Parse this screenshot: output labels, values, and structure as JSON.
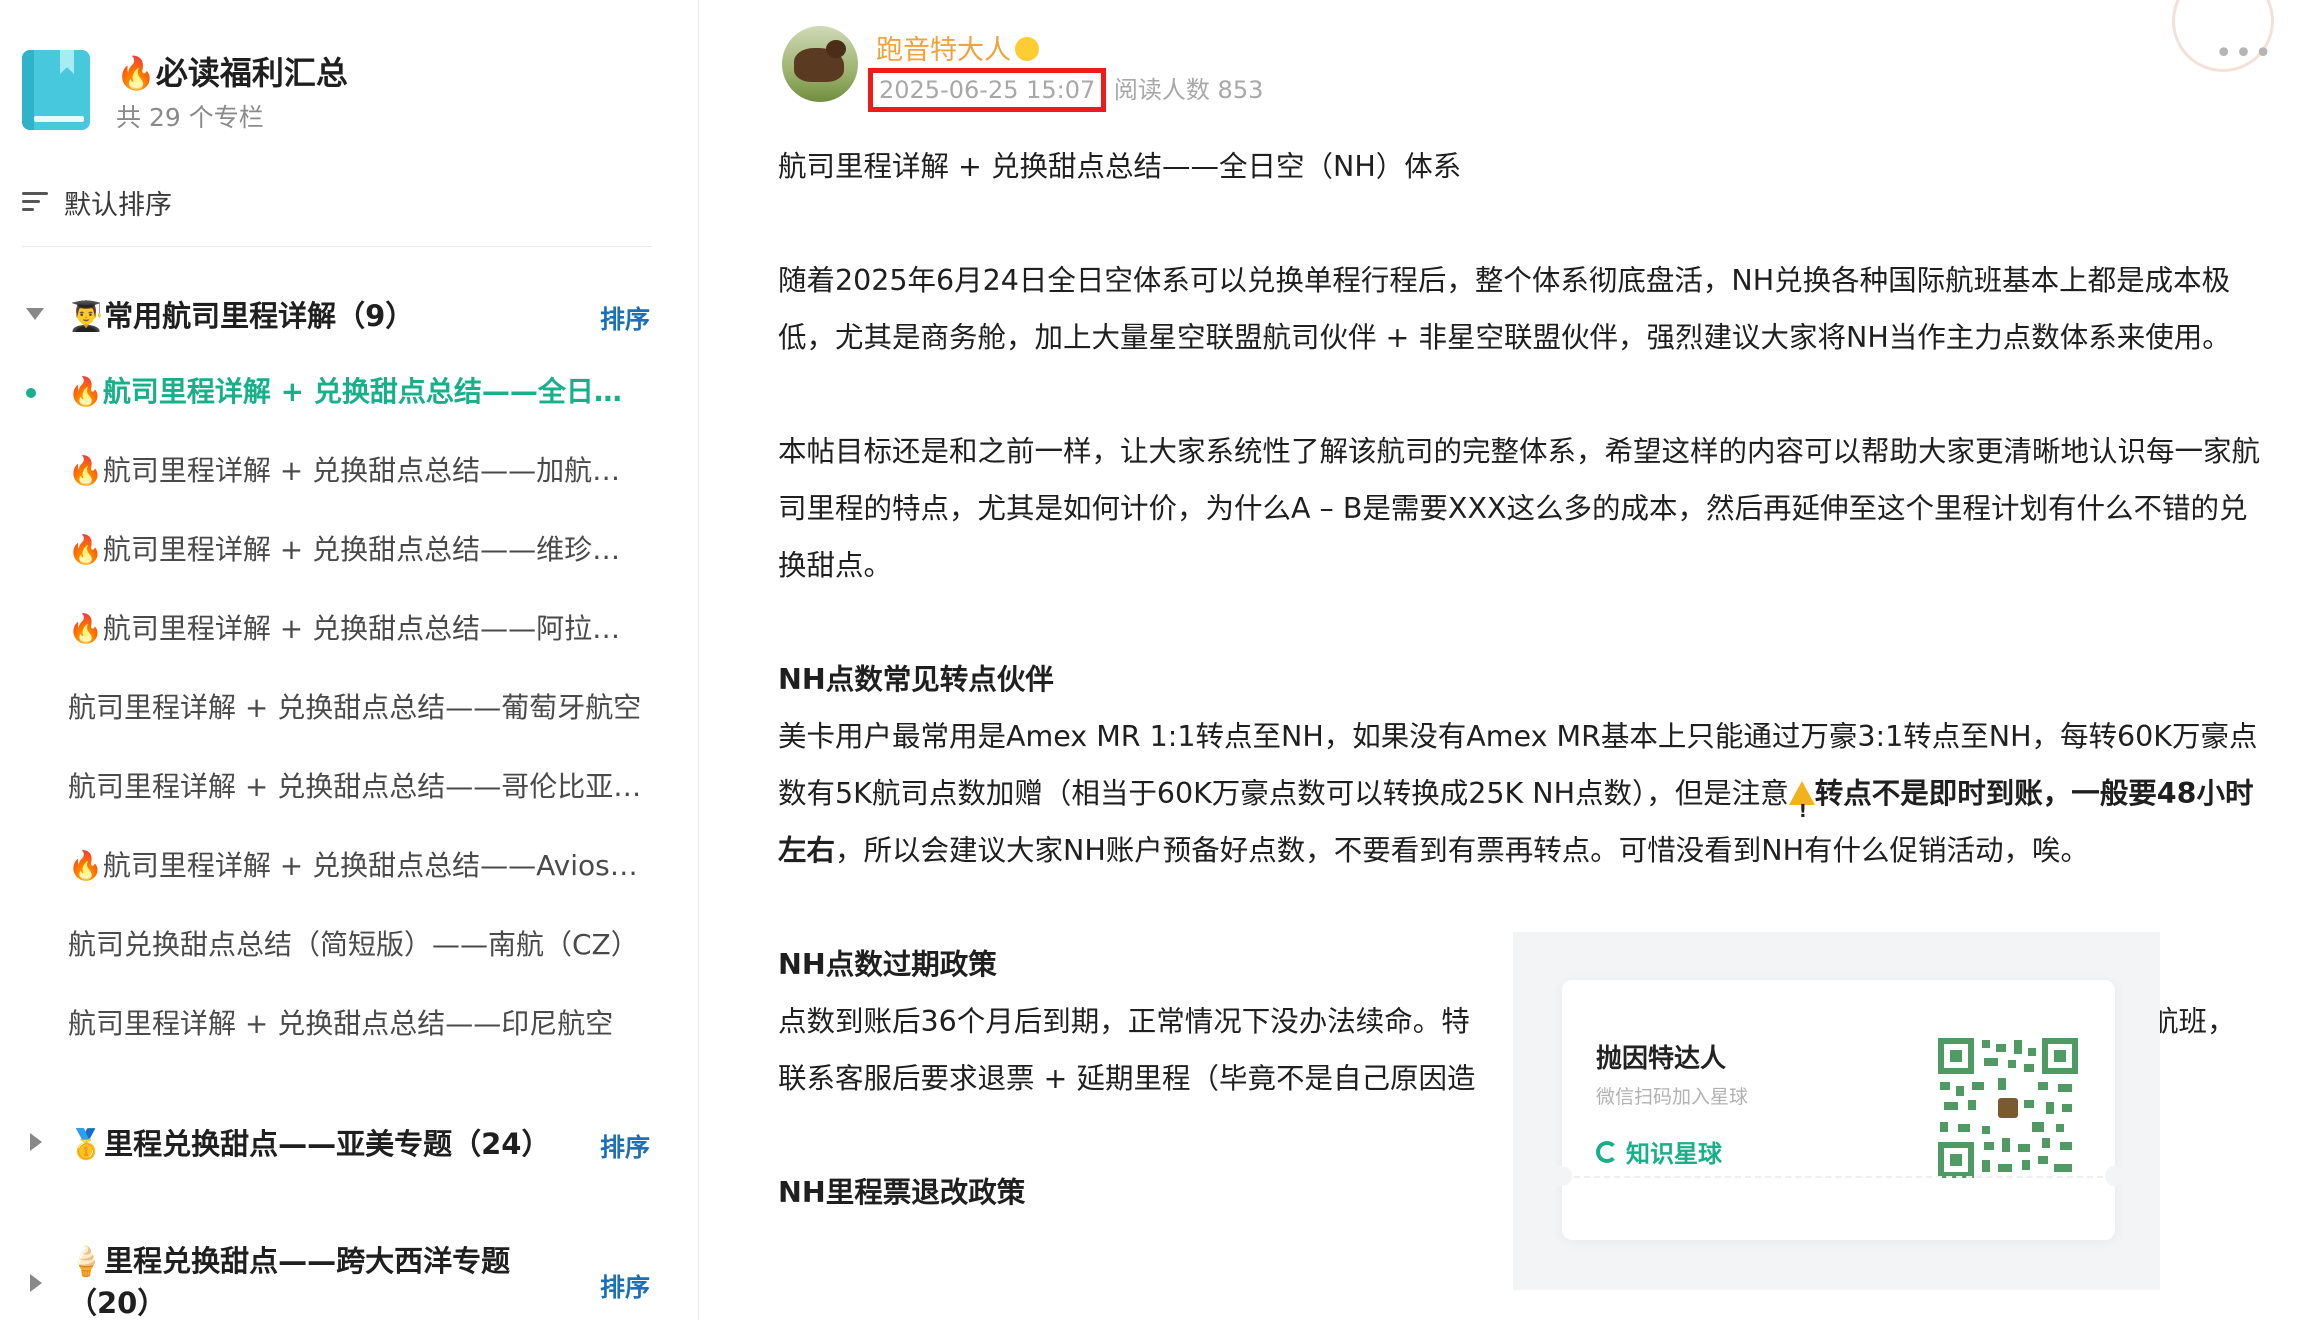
{
  "sidebar": {
    "column_title": "🔥必读福利汇总",
    "column_count": "共 29 个专栏",
    "sort_label": "默认排序",
    "groups": [
      {
        "title": "👨‍🎓常用航司里程详解（9）",
        "sort_label": "排序"
      },
      {
        "title": "🥇里程兑换甜点——亚美专题（24）",
        "sort_label": "排序"
      },
      {
        "title": "🍦里程兑换甜点——跨大西洋专题",
        "title_line2": "（20）",
        "sort_label": "排序"
      }
    ],
    "articles": [
      "🔥航司里程详解 + 兑换甜点总结——全日空（NH）体系",
      "🔥航司里程详解 + 兑换甜点总结——加航（AC）",
      "🔥航司里程详解 + 兑换甜点总结——维珍航空",
      "🔥航司里程详解 + 兑换甜点总结——阿拉斯加航空",
      "航司里程详解 + 兑换甜点总结——葡萄牙航空",
      "航司里程详解 + 兑换甜点总结——哥伦比亚航空",
      "🔥航司里程详解 + 兑换甜点总结——Avios体系",
      "航司兑换甜点总结（简短版）——南航（CZ）",
      "航司里程详解 + 兑换甜点总结——印尼航空"
    ],
    "active_index": 0
  },
  "post": {
    "author": "跑音特大人",
    "date": "2025-06-25 15:07",
    "views": "阅读人数 853",
    "title": "航司里程详解 + 兑换甜点总结——全日空（NH）体系",
    "p1": "随着2025年6月24日全日空体系可以兑换单程行程后，整个体系彻底盘活，NH兑换各种国际航班基本上都是成本极低，尤其是商务舱，加上大量星空联盟航司伙伴 + 非星空联盟伙伴，强烈建议大家将NH当作主力点数体系来使用。",
    "p2": "本帖目标还是和之前一样，让大家系统性了解该航司的完整体系，希望这样的内容可以帮助大家更清晰地认识每一家航司里程的特点，尤其是如何计价，为什么A – B是需要XXX这么多的成本，然后再延伸至这个里程计划有什么不错的兑换甜点。",
    "h1": "NH点数常见转点伙伴",
    "p3a": "美卡用户最常用是Amex MR 1:1转点至NH，如果没有Amex MR基本上只能通过万豪3:1转点至NH，每转60K万豪点数有5K航司点数加赠（相当于60K万豪点数可以转换成25K NH点数），但是注意",
    "p3b": "转点不是即时到账，一般要48小时左右",
    "p3c": "，所以会建议大家NH账户预备好点数，不要看到有票再转点。可惜没看到NH有什么促销活动，唉。",
    "h2": "NH点数过期政策",
    "p4a": "点数到账后36个月后到期，正常情况下没办法续命。特",
    "p4b": "航班，",
    "p4c": "联系客服后要求退票 + 延期里程（毕竟不是自己原因造",
    "h3": "NH里程票退改政策"
  },
  "overlay": {
    "name": "抛因特达人",
    "subtitle": "微信扫码加入星球",
    "brand": "知识星球"
  },
  "colors": {
    "accent_green": "#17b08a",
    "sort_blue": "#1f6fb5",
    "author_orange": "#f0a23c",
    "highlight_red": "#ee1b1b"
  }
}
